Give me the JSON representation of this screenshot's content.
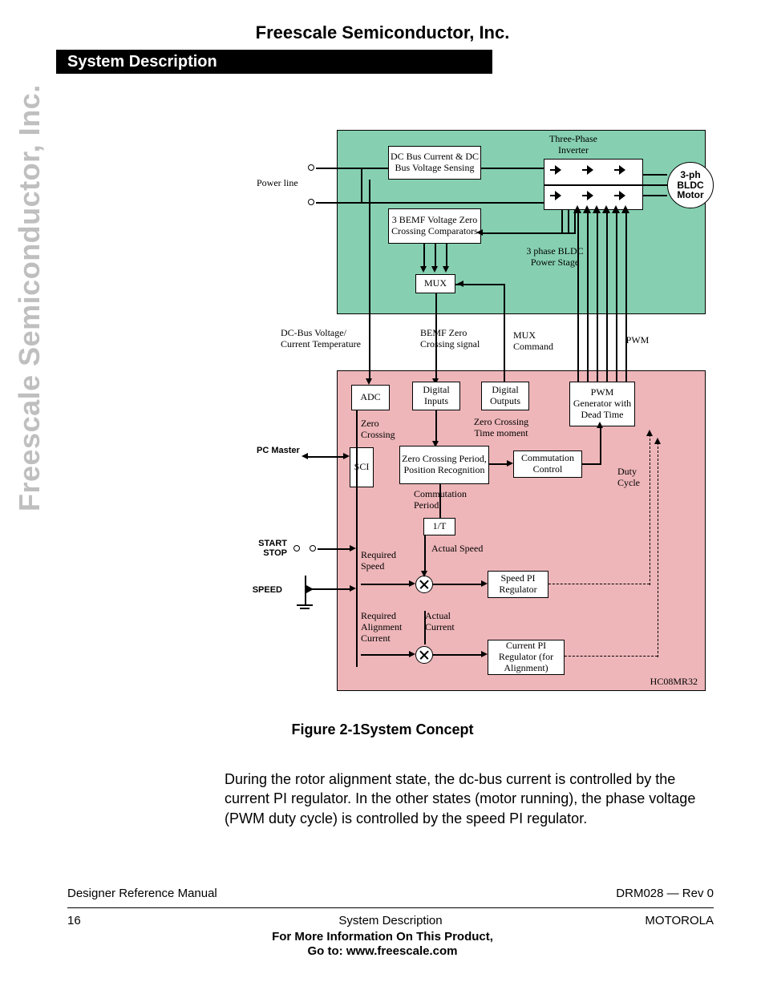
{
  "header": {
    "company": "Freescale Semiconductor, Inc.",
    "section_title": "System Description",
    "side_watermark": "Freescale Semiconductor, Inc."
  },
  "figure": {
    "caption": "Figure 2-1System Concept",
    "zoneA_label": "3 phase BLDC Power Stage",
    "zoneB_label": "HC08MR32",
    "power_line": "Power line",
    "dc_sense": "DC Bus Current & DC Bus Voltage Sensing",
    "bemf_comp": "3 BEMF Voltage Zero Crossing Comparators",
    "mux": "MUX",
    "inverter_label": "Three-Phase Inverter",
    "motor": "3-ph BLDC Motor",
    "dc_vit": "DC-Bus Voltage/ Current Temperature",
    "bemf_zc_sig": "BEMF Zero Crossing signal",
    "mux_cmd": "MUX Command",
    "pwm_lbl": "PWM",
    "adc": "ADC",
    "dig_in": "Digital Inputs",
    "dig_out": "Digital Outputs",
    "pwm_gen": "PWM Generator with Dead Time",
    "zc": "Zero Crossing",
    "zc_time": "Zero Crossing Time moment",
    "pc_master": "PC Master",
    "sci": "SCI",
    "zc_period": "Zero Crossing Period, Position Recognition",
    "comm_ctrl": "Commutation Control",
    "duty": "Duty Cycle",
    "comm_period": "Commutation Period",
    "one_t": "1/T",
    "start_stop1": "START",
    "start_stop2": "STOP",
    "speed_lbl": "SPEED",
    "req_speed": "Required Speed",
    "act_speed": "Actual Speed",
    "speed_pi": "Speed PI Regulator",
    "req_align": "Required Alignment Current",
    "act_current": "Actual Current",
    "cur_pi": "Current PI Regulator (for Alignment)"
  },
  "body_text": "During the rotor alignment state, the dc-bus current is controlled by the current PI regulator. In the other states (motor running), the phase voltage (PWM duty cycle) is controlled by the speed PI regulator.",
  "footer": {
    "left1": "Designer Reference Manual",
    "right1": "DRM028 — Rev 0",
    "pagenum": "16",
    "center2": "System Description",
    "right2": "MOTOROLA",
    "more": "For More Information On This Product,",
    "goto": "Go to: www.freescale.com"
  }
}
